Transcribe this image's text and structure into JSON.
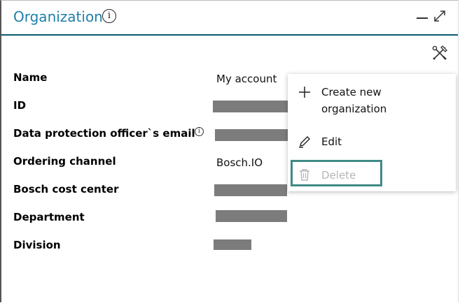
{
  "panel": {
    "title": "Organization",
    "info_icon": "info-icon",
    "minimize_icon": "minimize-icon",
    "expand_icon": "expand-icon",
    "tools_icon": "tools-icon"
  },
  "fields": [
    {
      "label": "Name",
      "value": "My account"
    },
    {
      "label": "ID",
      "value": ""
    },
    {
      "label": "Data protection officer`s email",
      "value": ""
    },
    {
      "label": "Ordering channel",
      "value": "Bosch.IO"
    },
    {
      "label": "Bosch cost center",
      "value": ""
    },
    {
      "label": "Department",
      "value": ""
    },
    {
      "label": "Division",
      "value": ""
    }
  ],
  "menu": {
    "items": [
      {
        "label": "Create new organization",
        "icon": "plus-icon",
        "enabled": true
      },
      {
        "label": "Edit",
        "icon": "pencil-icon",
        "enabled": true
      },
      {
        "label": "Delete",
        "icon": "trash-icon",
        "enabled": false
      }
    ]
  },
  "colors": {
    "title": "#1f7fa8",
    "header_border": "#0b5a6e",
    "highlight_border": "#3f8a86",
    "redaction": "#7c7c7c",
    "disabled_text": "#b5b5b5"
  }
}
